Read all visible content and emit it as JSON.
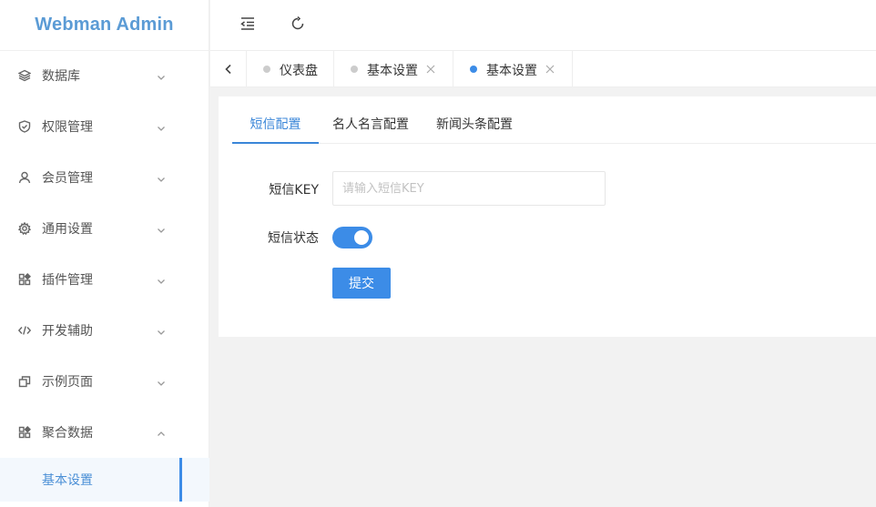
{
  "app": {
    "title": "Webman Admin"
  },
  "sidebar": {
    "items": [
      {
        "label": "数据库",
        "icon": "layers-icon"
      },
      {
        "label": "权限管理",
        "icon": "shield-check-icon"
      },
      {
        "label": "会员管理",
        "icon": "user-icon"
      },
      {
        "label": "通用设置",
        "icon": "gear-icon"
      },
      {
        "label": "插件管理",
        "icon": "apps-icon"
      },
      {
        "label": "开发辅助",
        "icon": "code-icon"
      },
      {
        "label": "示例页面",
        "icon": "copy-icon"
      },
      {
        "label": "聚合数据",
        "icon": "apps-icon"
      }
    ],
    "sub_item": {
      "label": "基本设置"
    }
  },
  "tabs": [
    {
      "label": "仪表盘",
      "active": false,
      "closable": false
    },
    {
      "label": "基本设置",
      "active": false,
      "closable": true
    },
    {
      "label": "基本设置",
      "active": true,
      "closable": true
    }
  ],
  "content": {
    "tabs": [
      {
        "label": "短信配置",
        "active": true
      },
      {
        "label": "名人名言配置",
        "active": false
      },
      {
        "label": "新闻头条配置",
        "active": false
      }
    ],
    "form": {
      "key_label": "短信KEY",
      "key_placeholder": "请输入短信KEY",
      "key_value": "",
      "status_label": "短信状态",
      "status_on": true,
      "submit_label": "提交"
    }
  },
  "colors": {
    "accent": "#3c8ce7",
    "logo": "#5b9bd5",
    "background": "#f2f2f2"
  }
}
